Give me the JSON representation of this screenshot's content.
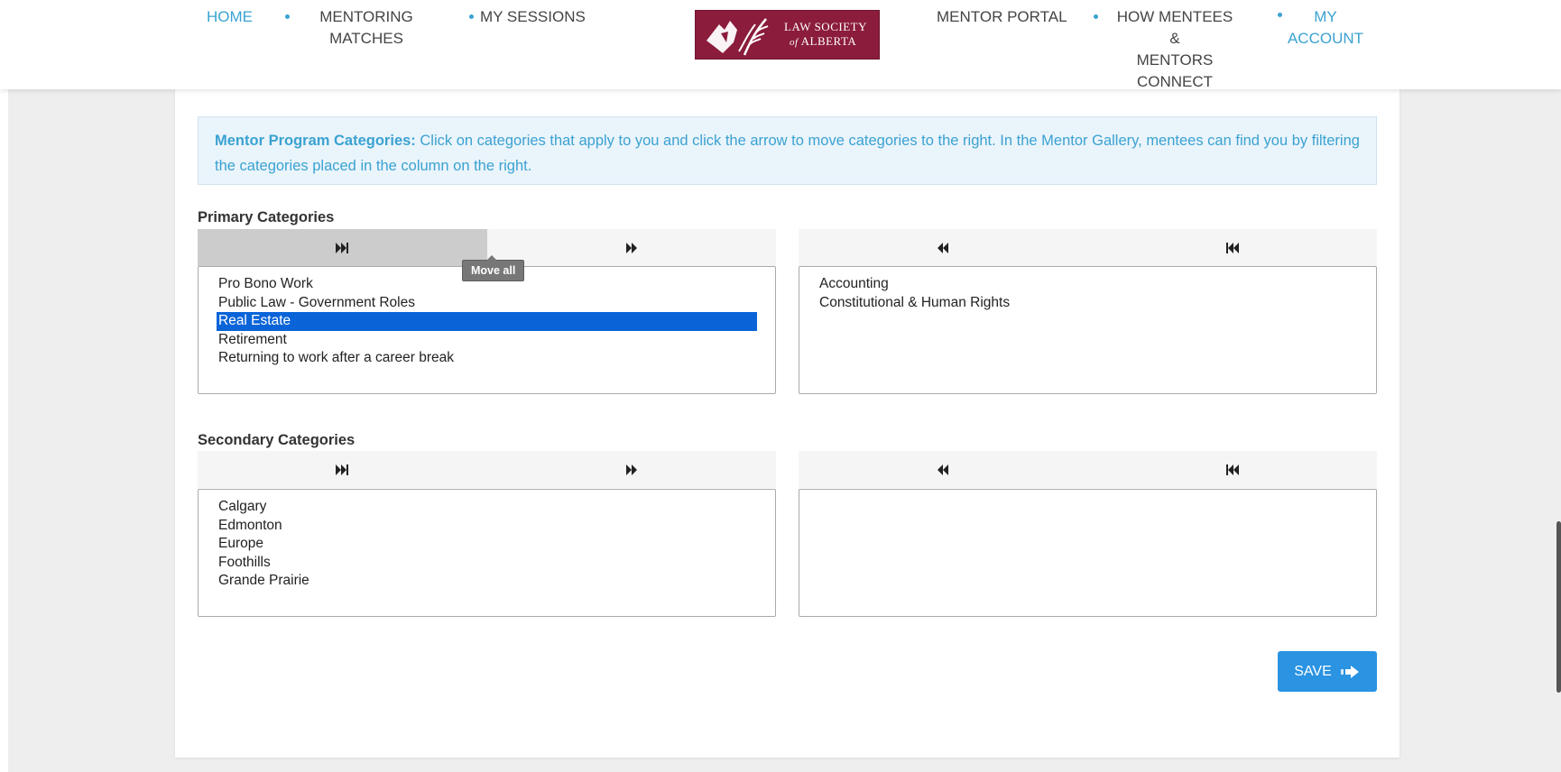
{
  "nav": {
    "home": "HOME",
    "matches_line1": "MENTORING",
    "matches_line2": "MATCHES",
    "sessions": "MY SESSIONS",
    "portal": "MENTOR PORTAL",
    "how_line1": "HOW MENTEES &",
    "how_line2": "MENTORS",
    "how_line3": "CONNECT",
    "account_line1": "MY",
    "account_line2": "ACCOUNT"
  },
  "logo": {
    "line1": "LAW SOCIETY",
    "line2_small": "of",
    "line2": "ALBERTA"
  },
  "info": {
    "heading": "Mentor Program Categories:",
    "text": "Click on categories that apply to you and click the arrow to move categories to the right. In the Mentor Gallery, mentees can find you by filtering the categories placed in the column on the right."
  },
  "primary": {
    "label": "Primary Categories",
    "available": [
      "Pro Bono Work",
      "Public Law - Government Roles",
      "Real Estate",
      "Retirement",
      "Returning to work after a career break"
    ],
    "selected_option": "Real Estate",
    "chosen": [
      "Accounting",
      "Constitutional & Human Rights"
    ]
  },
  "secondary": {
    "label": "Secondary Categories",
    "available": [
      "Calgary",
      "Edmonton",
      "Europe",
      "Foothills",
      "Grande Prairie"
    ],
    "chosen": []
  },
  "tooltip": "Move all",
  "save_label": "SAVE",
  "icons": {
    "move_all_right": "skip-forward-icon",
    "move_right": "fast-forward-icon",
    "move_left": "rewind-icon",
    "move_all_left": "skip-back-icon",
    "save": "arrow-right-icon"
  },
  "colors": {
    "accent": "#3aa2d1",
    "logo_bg": "#8b1c3b",
    "selected": "#0a64d8",
    "save_button": "#2a93e2",
    "info_bg": "#eaf4fb"
  }
}
